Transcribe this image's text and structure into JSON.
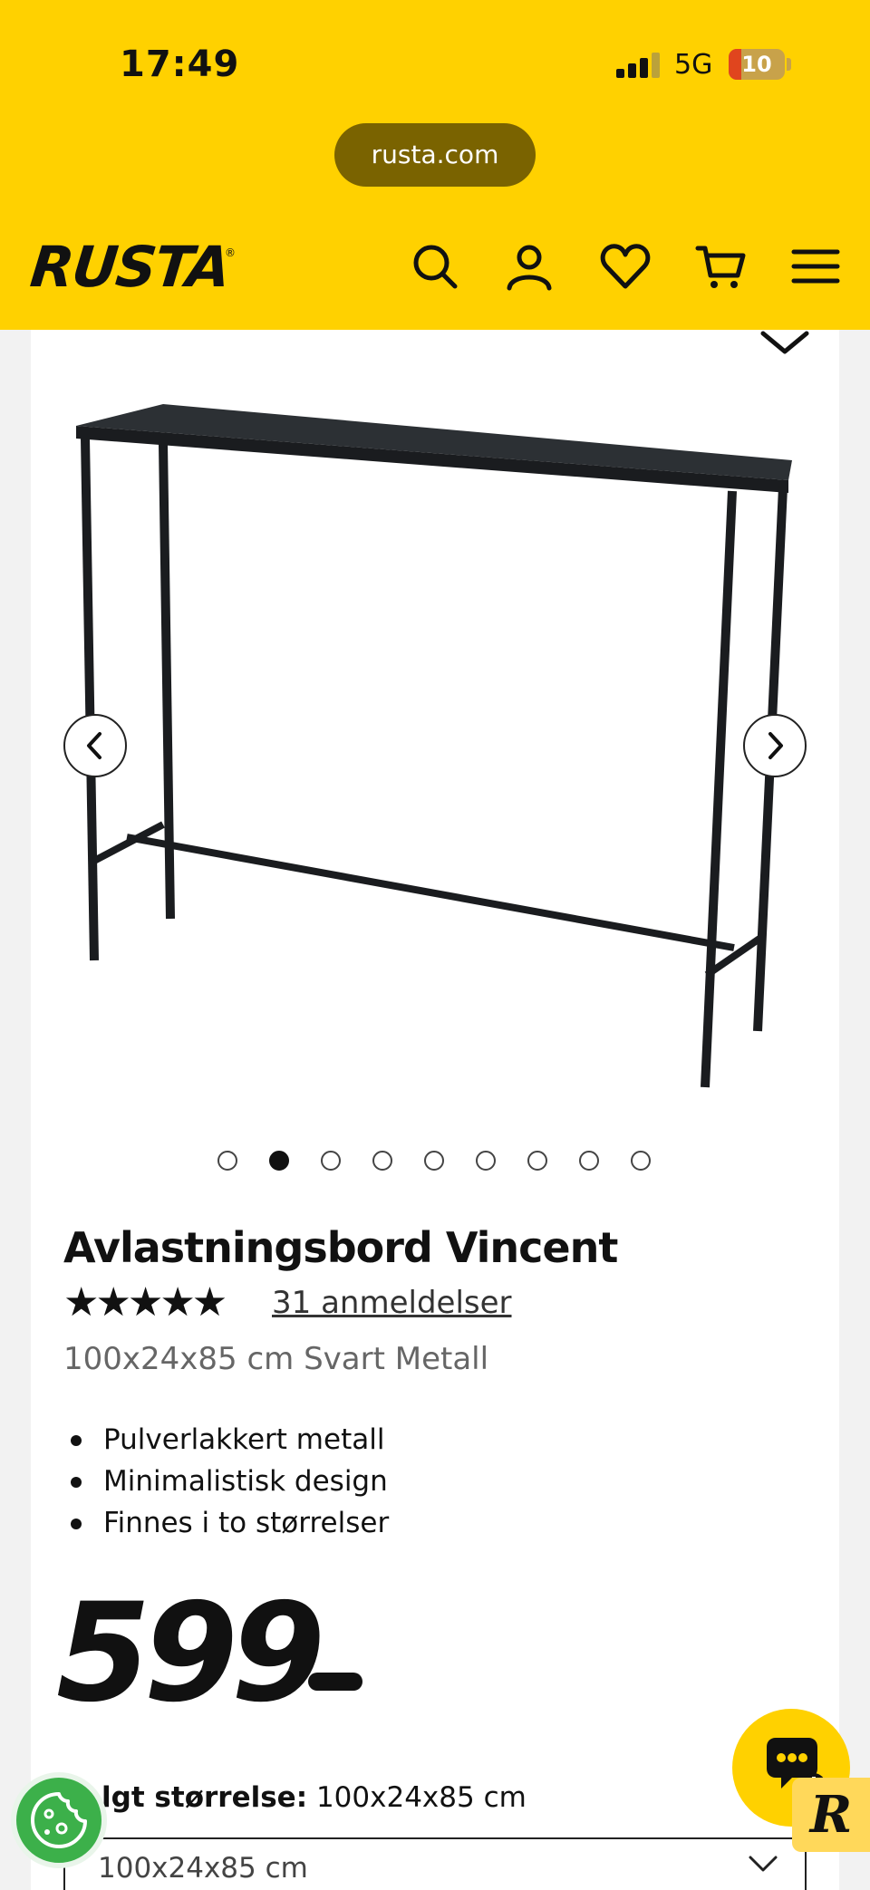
{
  "status_bar": {
    "time": "17:49",
    "network": "5G",
    "battery": "10",
    "battery_color": "#e0451e"
  },
  "browser": {
    "url": "rusta.com"
  },
  "header": {
    "logo": "RUSTA",
    "logo_mark": "®",
    "background": "#ffd100",
    "icons": [
      "search-icon",
      "account-icon",
      "heart-icon",
      "cart-icon",
      "menu-icon"
    ]
  },
  "gallery": {
    "image_alt": "Black metal console table",
    "dot_count": 9,
    "active_dot": 2
  },
  "product": {
    "title": "Avlastningsbord Vincent",
    "stars": "★★★★★",
    "rating_value": 5,
    "reviews": "31 anmeldelser",
    "variant": "100x24x85 cm Svart Metall",
    "bullets": [
      "Pulverlakkert metall",
      "Minimalistisk design",
      "Finnes i to størrelser"
    ],
    "price": "599",
    "size_label_prefix": "lgt størrelse:",
    "size_label_value": " 100x24x85 cm",
    "size_select_value": "100x24x85 cm"
  },
  "floating": {
    "cookie_color": "#3cb04a",
    "chat_color": "#ffd100",
    "badge": "R"
  }
}
